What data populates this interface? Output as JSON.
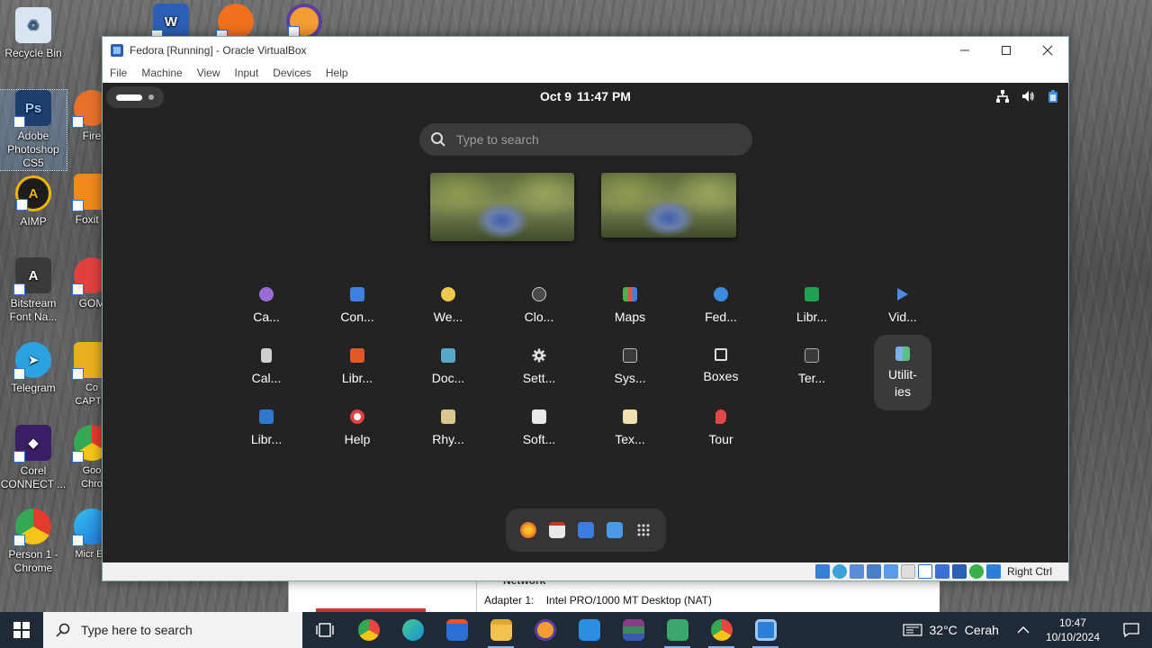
{
  "desktop": {
    "icons": [
      {
        "label": "Recycle Bin",
        "color": "#d9e6f2"
      },
      {
        "label": "Adobe Photoshop CS5",
        "color": "#1c3f6e",
        "glyph": "Ps"
      },
      {
        "label": "AIMP",
        "color": "#1d1d1d",
        "glyph": "A"
      },
      {
        "label": "Bitstream Font Na...",
        "color": "#3a3a3a",
        "glyph": "A"
      },
      {
        "label": "Telegram",
        "color": "#2aa3e0",
        "glyph": "➤"
      },
      {
        "label": "Corel CONNECT ...",
        "color": "#3b1f66",
        "glyph": "◆"
      },
      {
        "label": "Person 1 - Chrome",
        "color": "#e33b2e",
        "glyph": "●"
      }
    ],
    "icons_col2": [
      {
        "label": "Fire",
        "color": "#e8702a"
      },
      {
        "label": "Foxit F",
        "color": "#f08a1c"
      },
      {
        "label": "GOM",
        "color": "#e04040"
      },
      {
        "label": "Co CAPTU",
        "color": "#e8b020"
      },
      {
        "label": "Goo Chro",
        "color": "#34a853"
      },
      {
        "label": "Micr Ed",
        "color": "#1e88e5"
      }
    ]
  },
  "behind_window": {
    "section_title": "Network",
    "adapter_label": "Adapter 1:",
    "adapter_value": "Intel PRO/1000 MT Desktop (NAT)"
  },
  "vbox": {
    "title": "Fedora [Running] - Oracle VirtualBox",
    "menu": [
      "File",
      "Machine",
      "View",
      "Input",
      "Devices",
      "Help"
    ],
    "host_key": "Right Ctrl"
  },
  "fedora": {
    "date": "Oct 9",
    "time": "11:47 PM",
    "search_placeholder": "Type to search",
    "apps": [
      {
        "label": "Ca...",
        "color": "#9b6bd8",
        "icon": "camera-icon"
      },
      {
        "label": "Con...",
        "color": "#3f7fe0",
        "icon": "contacts-icon"
      },
      {
        "label": "We...",
        "color": "#f2c94c",
        "icon": "weather-icon"
      },
      {
        "label": "Clo...",
        "color": "#4a4a4a",
        "icon": "clocks-icon"
      },
      {
        "label": "Maps",
        "color": "#e0563f",
        "icon": "maps-icon"
      },
      {
        "label": "Fed...",
        "color": "#3c8be0",
        "icon": "fedora-media-writer-icon"
      },
      {
        "label": "Libr...",
        "color": "#20a050",
        "icon": "libreoffice-calc-icon"
      },
      {
        "label": "Vid...",
        "color": "#4d8ae6",
        "icon": "videos-icon"
      },
      {
        "label": "Cal...",
        "color": "#cfcfcf",
        "icon": "calculator-icon"
      },
      {
        "label": "Libr...",
        "color": "#e05a28",
        "icon": "libreoffice-impress-icon"
      },
      {
        "label": "Doc...",
        "color": "#58a8c8",
        "icon": "document-viewer-icon"
      },
      {
        "label": "Sett...",
        "color": "#dddddd",
        "icon": "settings-icon"
      },
      {
        "label": "Sys...",
        "color": "#3a3a3a",
        "icon": "system-monitor-icon"
      },
      {
        "label": "Boxes",
        "color": "#dddddd",
        "icon": "boxes-icon"
      },
      {
        "label": "Ter...",
        "color": "#3a3a3a",
        "icon": "terminal-icon"
      },
      {
        "label": "Utilit-ies",
        "color": "#7ab0f0",
        "icon": "utilities-folder-icon"
      },
      {
        "label": "Libr...",
        "color": "#2f78d0",
        "icon": "libreoffice-writer-icon"
      },
      {
        "label": "Help",
        "color": "#e04040",
        "icon": "help-icon"
      },
      {
        "label": "Rhy...",
        "color": "#d8c890",
        "icon": "rhythmbox-icon"
      },
      {
        "label": "Soft...",
        "color": "#e8e8e8",
        "icon": "software-icon"
      },
      {
        "label": "Tex...",
        "color": "#f0e0b0",
        "icon": "text-editor-icon"
      },
      {
        "label": "Tour",
        "color": "#e04848",
        "icon": "tour-icon"
      }
    ],
    "utilities_label": "Utilit-ies",
    "dash": [
      {
        "name": "firefox",
        "color": "#f07a1c"
      },
      {
        "name": "calendar",
        "color": "#e8e8e8"
      },
      {
        "name": "writer",
        "color": "#3c7ee0"
      },
      {
        "name": "software",
        "color": "#4a9ae6"
      },
      {
        "name": "app-grid",
        "color": "#353535"
      }
    ]
  },
  "taskbar": {
    "search_placeholder": "Type here to search",
    "weather_temp": "32°C",
    "weather_desc": "Cerah",
    "time": "10:47",
    "date": "10/10/2024",
    "apps": [
      {
        "name": "task-view",
        "color": "#1f2a36"
      },
      {
        "name": "chrome",
        "color": "#e8453c"
      },
      {
        "name": "edge",
        "color": "#1a8cdb"
      },
      {
        "name": "store",
        "color": "#2b6fd6"
      },
      {
        "name": "file-explorer",
        "color": "#f2c14e"
      },
      {
        "name": "vpn",
        "color": "#f39c32"
      },
      {
        "name": "vscode",
        "color": "#2a8fe0"
      },
      {
        "name": "winrar",
        "color": "#8a3a8a"
      },
      {
        "name": "corel",
        "color": "#3aa86a"
      },
      {
        "name": "chrome-profile",
        "color": "#e8453c"
      },
      {
        "name": "virtualbox",
        "color": "#2b7fd6"
      }
    ]
  }
}
